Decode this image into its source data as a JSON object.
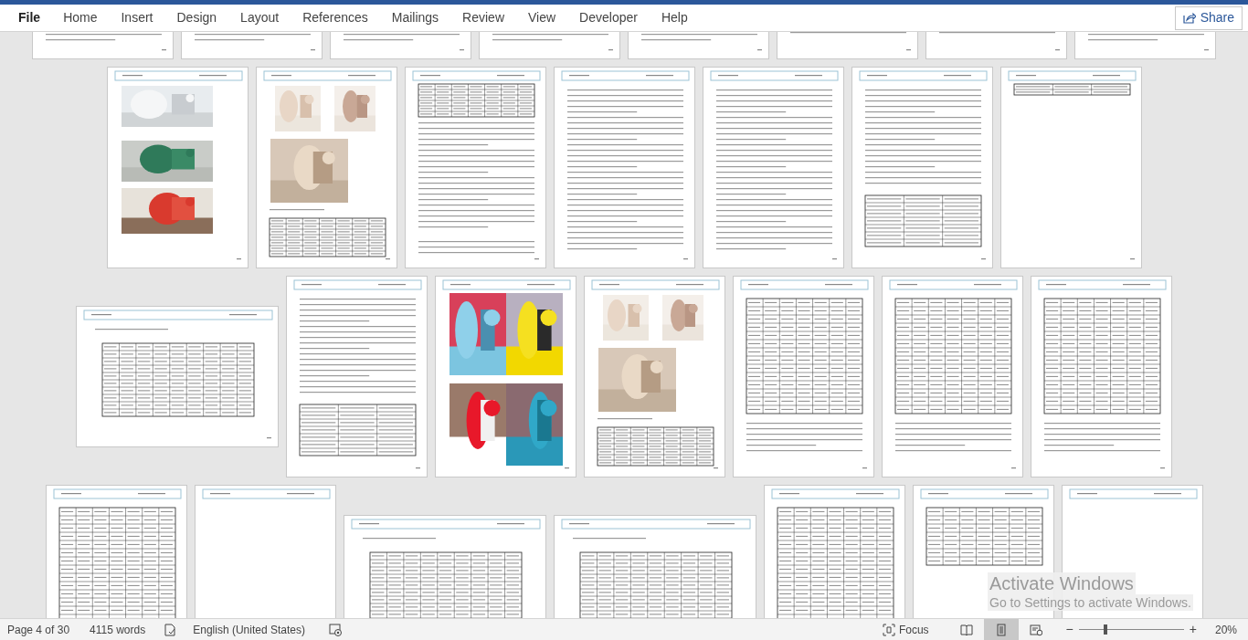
{
  "ribbon": {
    "tabs": [
      {
        "label": "File",
        "kind": "file"
      },
      {
        "label": "Home",
        "kind": "tab"
      },
      {
        "label": "Insert",
        "kind": "tab"
      },
      {
        "label": "Design",
        "kind": "tab"
      },
      {
        "label": "Layout",
        "kind": "tab"
      },
      {
        "label": "References",
        "kind": "tab"
      },
      {
        "label": "Mailings",
        "kind": "tab"
      },
      {
        "label": "Review",
        "kind": "tab"
      },
      {
        "label": "View",
        "kind": "tab"
      },
      {
        "label": "Developer",
        "kind": "tab"
      },
      {
        "label": "Help",
        "kind": "tab"
      }
    ],
    "share_button": "Share"
  },
  "document": {
    "rows": [
      {
        "pages": [
          {
            "kind": "text"
          },
          {
            "kind": "text"
          },
          {
            "kind": "text"
          },
          {
            "kind": "text"
          },
          {
            "kind": "text"
          },
          {
            "kind": "table"
          },
          {
            "kind": "table"
          },
          {
            "kind": "text"
          }
        ]
      },
      {
        "pages": [
          {
            "kind": "machines"
          },
          {
            "kind": "photos-table"
          },
          {
            "kind": "table-text"
          },
          {
            "kind": "text"
          },
          {
            "kind": "text"
          },
          {
            "kind": "text-table"
          },
          {
            "kind": "short"
          }
        ]
      },
      {
        "pages": [
          {
            "kind": "landscape"
          },
          {
            "kind": "text-table"
          },
          {
            "kind": "garments"
          },
          {
            "kind": "photos-table"
          },
          {
            "kind": "table"
          },
          {
            "kind": "table"
          },
          {
            "kind": "table"
          }
        ]
      },
      {
        "pages": [
          {
            "kind": "table"
          },
          {
            "kind": "blank"
          },
          {
            "kind": "landscape"
          },
          {
            "kind": "landscape"
          },
          {
            "kind": "table"
          },
          {
            "kind": "table-top"
          },
          {
            "kind": "blank"
          }
        ]
      }
    ]
  },
  "activation_notice": {
    "title": "Activate Windows",
    "message": "Go to Settings to activate Windows."
  },
  "status_bar": {
    "page": "Page 4 of 30",
    "words": "4115 words",
    "language": "English (United States)",
    "focus": "Focus",
    "views": [
      {
        "kind": "read",
        "selected": false
      },
      {
        "kind": "print",
        "selected": true
      },
      {
        "kind": "web",
        "selected": false
      }
    ],
    "zoom": {
      "minus": "−",
      "plus": "+",
      "level": 0.25,
      "percent": "20%"
    }
  }
}
